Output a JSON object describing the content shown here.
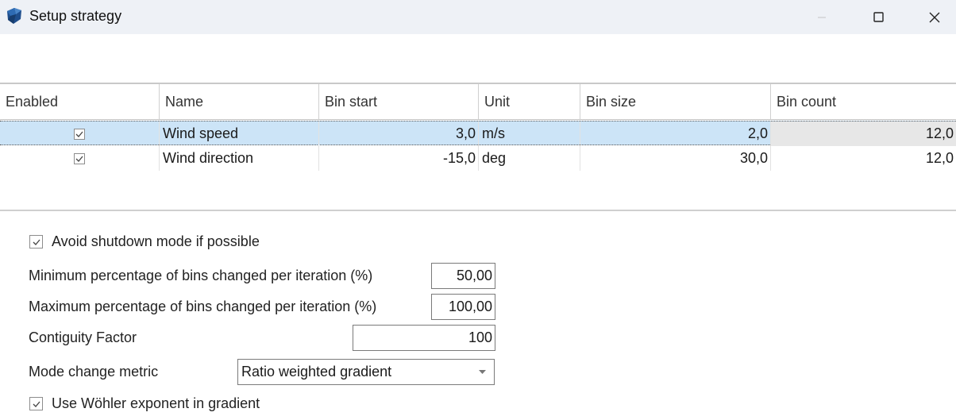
{
  "window": {
    "title": "Setup strategy",
    "app_icon": "app-logo-icon",
    "controls": [
      "minimize-icon",
      "maximize-icon",
      "close-icon"
    ]
  },
  "grid": {
    "columns": [
      "Enabled",
      "Name",
      "Bin start",
      "Unit",
      "Bin size",
      "Bin count"
    ],
    "rows": [
      {
        "enabled": true,
        "name": "Wind speed",
        "bin_start": "3,0",
        "unit": "m/s",
        "bin_size": "2,0",
        "bin_count": "12,0",
        "selected": true
      },
      {
        "enabled": true,
        "name": "Wind direction",
        "bin_start": "-15,0",
        "unit": "deg",
        "bin_size": "30,0",
        "bin_count": "12,0",
        "selected": false
      }
    ]
  },
  "options": {
    "avoid_shutdown": {
      "label": "Avoid shutdown mode if possible",
      "checked": true
    },
    "min_pct": {
      "label": "Minimum percentage of bins changed per iteration (%)",
      "value": "50,00"
    },
    "max_pct": {
      "label": "Maximum percentage of bins changed per iteration (%)",
      "value": "100,00"
    },
    "contiguity": {
      "label": "Contiguity Factor",
      "value": "100"
    },
    "mode_metric": {
      "label": "Mode change metric",
      "value": "Ratio weighted gradient"
    },
    "use_wohler": {
      "label": "Use Wöhler exponent in gradient",
      "checked": true
    }
  },
  "colors": {
    "titlebar_bg": "#eef1f6",
    "selected_row": "#cce4f7",
    "readonly_cell": "#e7e7e7"
  }
}
